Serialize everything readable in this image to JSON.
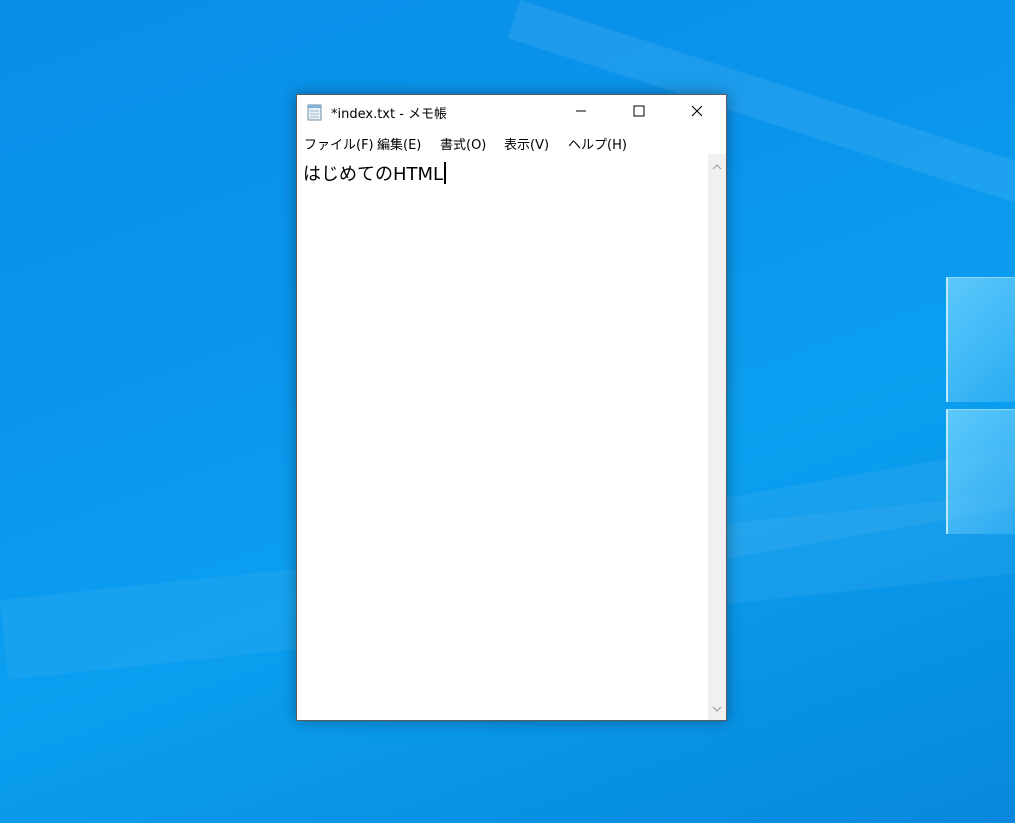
{
  "window": {
    "title": "*index.txt - メモ帳",
    "minimize_icon": "minimize-icon",
    "maximize_icon": "maximize-icon",
    "close_icon": "close-icon",
    "app_icon": "notepad-icon"
  },
  "menu": {
    "items": [
      {
        "label": "ファイル(F)"
      },
      {
        "label": "編集(E)"
      },
      {
        "label": "書式(O)"
      },
      {
        "label": "表示(V)"
      },
      {
        "label": "ヘルプ(H)"
      }
    ]
  },
  "editor": {
    "content": "はじめてのHTML"
  },
  "colors": {
    "desktop_accent": "#0a95ec",
    "window_bg": "#ffffff",
    "scrollbar_bg": "#f0f0f0"
  }
}
